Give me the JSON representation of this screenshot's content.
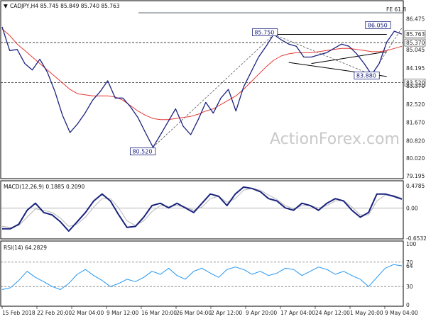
{
  "header": {
    "symbol_text": "CADJPY,H4 85.745 85.849 85.740 85.763"
  },
  "watermark": "ActionForex.com",
  "colors": {
    "price": "#1a237e",
    "ma": "#e53935",
    "macd": "#1a237e",
    "signal": "#b8b8b8",
    "rsi": "#2196f3",
    "frame": "#000000",
    "fe_line": "#37474f"
  },
  "chart_data": [
    {
      "type": "line",
      "panel": "price",
      "ylim": [
        79.195,
        86.95
      ],
      "y_ticks": [
        "86.475",
        "85.763",
        "85.370",
        "85.045",
        "84.195",
        "83.520",
        "83.370",
        "82.520",
        "81.670",
        "80.820",
        "80.020",
        "79.195"
      ],
      "highlight_ticks": [
        "85.763",
        "85.370",
        "83.520"
      ],
      "x": [
        "15 Feb 2018",
        "22 Feb 20:00",
        "2 Mar 04:00",
        "9 Mar 12:00",
        "16 Mar 20:00",
        "26 Mar 04:00",
        "2 Apr 12:00",
        "9 Apr 20:00",
        "17 Apr 04:00",
        "24 Apr 12:00",
        "1 May 20:00",
        "9 May 04:00"
      ],
      "series": [
        {
          "values": [
            86.1,
            85.0,
            85.05,
            84.4,
            84.1,
            84.6,
            84.0,
            83.1,
            82.0,
            81.2,
            81.6,
            82.1,
            82.7,
            83.1,
            83.6,
            82.8,
            82.8,
            82.4,
            81.9,
            81.2,
            80.52,
            81.1,
            81.7,
            82.3,
            81.5,
            81.1,
            81.8,
            82.6,
            82.1,
            82.8,
            83.2,
            82.2,
            83.3,
            84.0,
            84.7,
            85.2,
            85.75,
            85.5,
            85.3,
            85.2,
            84.7,
            84.7,
            84.8,
            84.9,
            85.1,
            85.3,
            85.2,
            84.85,
            84.4,
            83.88,
            84.4,
            85.4,
            85.9,
            85.763
          ]
        },
        {
          "values": [
            86.0,
            85.7,
            85.3,
            85.0,
            84.7,
            84.4,
            84.1,
            83.8,
            83.5,
            83.2,
            83.0,
            82.95,
            82.9,
            82.9,
            82.9,
            82.85,
            82.7,
            82.45,
            82.2,
            82.0,
            81.85,
            81.8,
            81.8,
            81.85,
            81.9,
            81.95,
            82.05,
            82.2,
            82.3,
            82.5,
            82.7,
            82.9,
            83.2,
            83.55,
            83.9,
            84.25,
            84.55,
            84.75,
            84.85,
            84.9,
            84.9,
            84.9,
            84.95,
            85.0,
            85.05,
            85.1,
            85.1,
            85.05,
            85.0,
            84.95,
            84.95,
            85.0,
            85.1,
            85.2
          ]
        }
      ],
      "horizontal_levels": [
        85.37,
        83.52
      ],
      "annotations": [
        {
          "text": "85.750",
          "price": 85.75
        },
        {
          "text": "86.050",
          "price": 86.05
        },
        {
          "text": "80.520",
          "price": 80.52
        },
        {
          "text": "83.880",
          "price": 83.88
        },
        {
          "text": "FE 61.8",
          "price": 86.75
        }
      ]
    },
    {
      "type": "line",
      "panel": "macd",
      "title": "MACD(12,26,9) 0.1885 0.2090",
      "ylim": [
        -0.6532,
        0.4785
      ],
      "y_ticks": [
        "0.4785",
        "0.00",
        "-0.6532"
      ],
      "zero_line": 0,
      "series": [
        {
          "values": [
            -0.45,
            -0.45,
            -0.35,
            -0.05,
            0.1,
            -0.1,
            -0.15,
            -0.3,
            -0.5,
            -0.3,
            -0.1,
            0.15,
            0.3,
            0.15,
            -0.15,
            -0.42,
            -0.4,
            -0.2,
            0.05,
            0.1,
            0.0,
            0.1,
            0.0,
            -0.1,
            0.1,
            0.3,
            0.25,
            0.05,
            0.3,
            0.45,
            0.42,
            0.35,
            0.2,
            0.15,
            0.0,
            -0.05,
            0.1,
            0.05,
            -0.05,
            0.1,
            0.2,
            0.15,
            -0.05,
            -0.2,
            -0.1,
            0.3,
            0.3,
            0.25,
            0.19
          ]
        },
        {
          "values": [
            -0.4,
            -0.42,
            -0.38,
            -0.2,
            -0.02,
            -0.05,
            -0.1,
            -0.22,
            -0.4,
            -0.35,
            -0.2,
            0.02,
            0.2,
            0.2,
            0.0,
            -0.28,
            -0.38,
            -0.28,
            -0.08,
            0.05,
            0.03,
            0.05,
            0.02,
            -0.05,
            0.02,
            0.2,
            0.25,
            0.12,
            0.2,
            0.38,
            0.42,
            0.38,
            0.28,
            0.18,
            0.05,
            -0.02,
            0.05,
            0.05,
            0.0,
            0.05,
            0.15,
            0.16,
            0.02,
            -0.15,
            -0.15,
            0.15,
            0.28,
            0.27,
            0.21
          ]
        }
      ]
    },
    {
      "type": "line",
      "panel": "rsi",
      "title": "RSI(14) 64.2829",
      "ylim": [
        0,
        100
      ],
      "y_ticks": [
        "100",
        "70",
        "64",
        "30",
        "0"
      ],
      "levels": [
        70,
        30
      ],
      "series": [
        {
          "values": [
            25,
            28,
            40,
            55,
            45,
            38,
            30,
            25,
            35,
            50,
            58,
            48,
            40,
            30,
            35,
            42,
            38,
            45,
            55,
            50,
            60,
            48,
            42,
            55,
            60,
            52,
            45,
            58,
            62,
            58,
            50,
            55,
            48,
            52,
            60,
            58,
            48,
            55,
            62,
            58,
            50,
            55,
            48,
            42,
            30,
            45,
            60,
            66,
            64
          ]
        }
      ]
    }
  ]
}
